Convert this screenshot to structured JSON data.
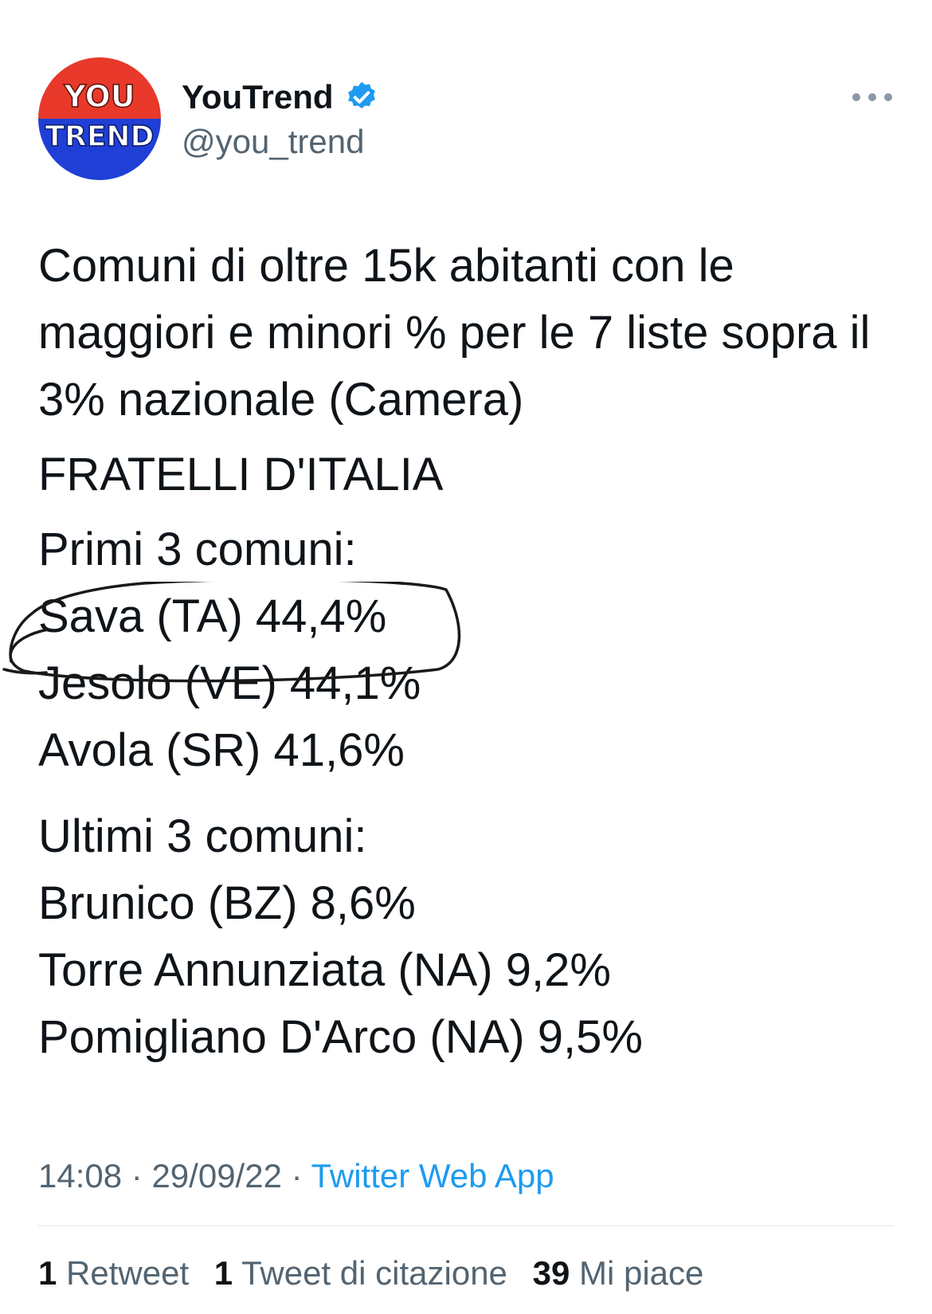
{
  "author": {
    "name": "YouTrend",
    "handle": "@you_trend",
    "avatar_line1": "YOU",
    "avatar_line2": "TREND",
    "verified": true
  },
  "tweet": {
    "intro": "Comuni di oltre 15k abitanti con le maggiori e minori % per le 7 liste sopra il 3% nazionale (Camera)",
    "party": "FRATELLI D'ITALIA",
    "top_heading": "Primi 3 comuni:",
    "top": [
      "Sava (TA) 44,4%",
      "Jesolo (VE) 44,1%",
      "Avola (SR) 41,6%"
    ],
    "bottom_heading": "Ultimi 3 comuni:",
    "bottom": [
      "Brunico (BZ) 8,6%",
      "Torre Annunziata (NA) 9,2%",
      "Pomigliano D'Arco (NA) 9,5%"
    ]
  },
  "meta": {
    "time": "14:08",
    "date": "29/09/22",
    "separator": "·",
    "source": "Twitter Web App"
  },
  "stats": {
    "retweets_count": "1",
    "retweets_label": "Retweet",
    "quotes_count": "1",
    "quotes_label": "Tweet di citazione",
    "likes_count": "39",
    "likes_label": "Mi piace"
  },
  "colors": {
    "avatar_top": "#e8392b",
    "avatar_bottom": "#1f3fd6",
    "verified": "#1d9bf0",
    "link": "#1d9bf0",
    "secondary_text": "#536471"
  }
}
